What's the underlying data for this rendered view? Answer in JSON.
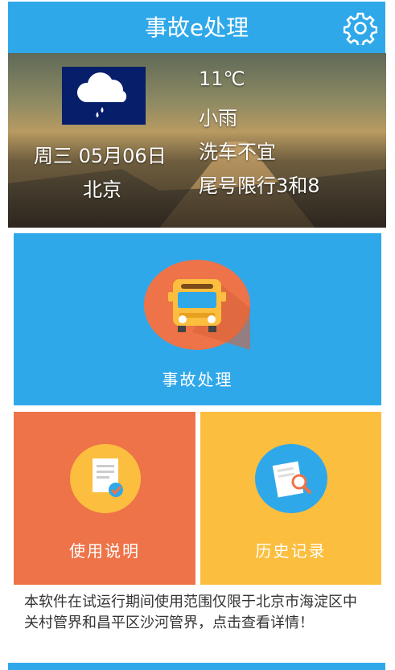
{
  "header": {
    "title": "事故e处理",
    "settings_icon": "gear-icon"
  },
  "weather": {
    "icon": "rain-cloud-icon",
    "temperature": "11℃",
    "condition": "小雨",
    "car_wash": "洗车不宜",
    "plate_restriction": "尾号限行3和8",
    "date": "周三 05月06日",
    "city": "北京"
  },
  "tiles": {
    "main": {
      "label": "事故处理",
      "icon": "bus-icon"
    },
    "manual": {
      "label": "使用说明",
      "icon": "document-check-icon"
    },
    "history": {
      "label": "历史记录",
      "icon": "document-search-icon"
    }
  },
  "notice": "本软件在试运行期间使用范围仅限于北京市海淀区中关村管界和昌平区沙河管界，点击查看详情！",
  "colors": {
    "primary": "#2fa8ea",
    "orange": "#ee7348",
    "yellow": "#fbbe3e"
  }
}
